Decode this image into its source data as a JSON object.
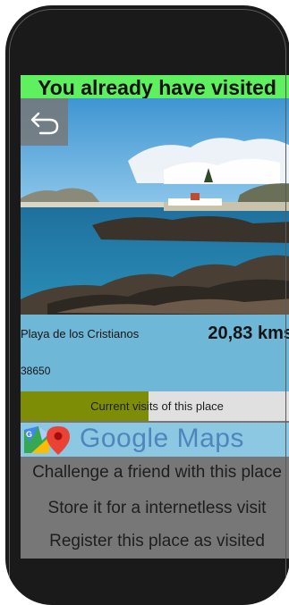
{
  "banner": {
    "text": "You already have visited"
  },
  "place": {
    "name": "Playa de los Cristianos",
    "distance": "20,83 kms",
    "postal_code": "38650"
  },
  "visits": {
    "label": "Current visits of this place",
    "fill_fraction": 0.47
  },
  "maps": {
    "label": "Google Maps",
    "icon": "google-maps-pin-icon"
  },
  "actions": {
    "challenge": "Challenge a friend with this place",
    "store": "Store it for a internetless visit",
    "register": "Register this place as visited"
  },
  "icons": {
    "back": "back-arrow-icon"
  },
  "colors": {
    "banner_bg": "#5ef05e",
    "info_bg": "#6fb7d6",
    "visits_fill": "#7d8e06",
    "maps_bg": "#8dc8e2",
    "buttons_bg": "#777777"
  }
}
